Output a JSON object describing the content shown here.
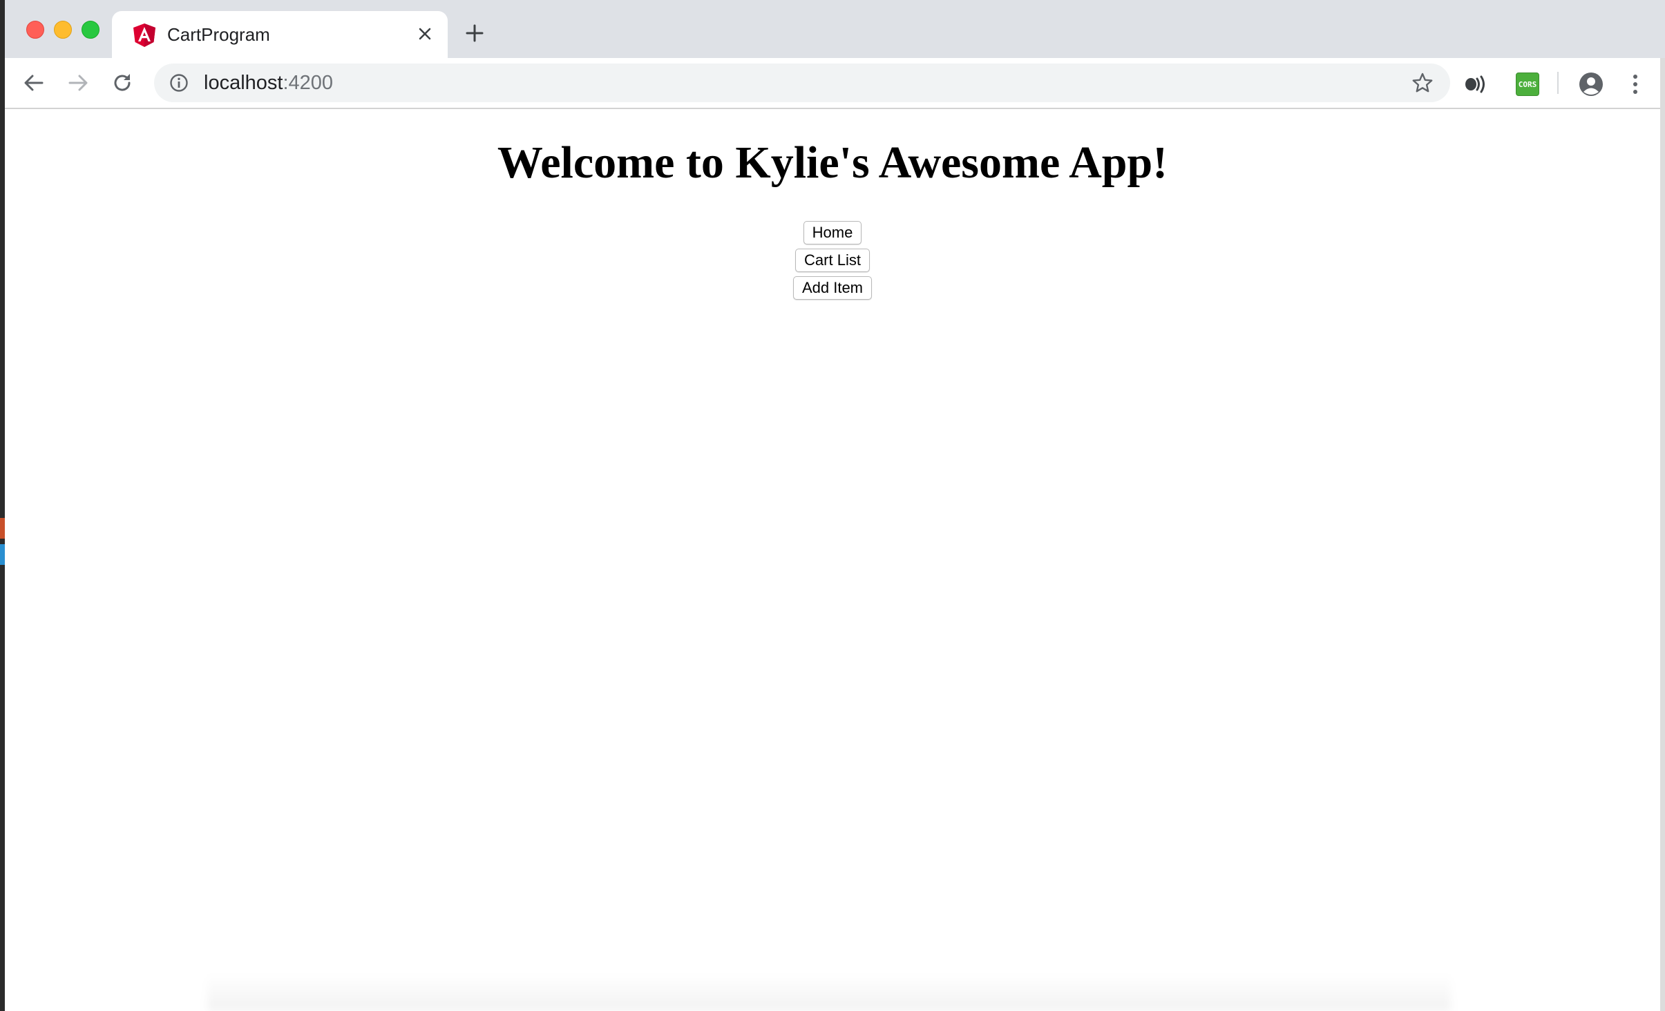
{
  "browser": {
    "tab": {
      "title": "CartProgram",
      "favicon": "angular-icon"
    },
    "address_bar": {
      "host": "localhost",
      "port": ":4200"
    },
    "extensions": {
      "cors_label": "CORS"
    }
  },
  "page": {
    "heading": "Welcome to Kylie's Awesome App!",
    "nav_buttons": [
      {
        "label": "Home"
      },
      {
        "label": "Cart List"
      },
      {
        "label": "Add Item"
      }
    ]
  },
  "colors": {
    "tabbar": "#dee1e6",
    "omnibox": "#f1f3f4",
    "angular_red": "#dd0031",
    "cors_green": "#4caf3c"
  }
}
